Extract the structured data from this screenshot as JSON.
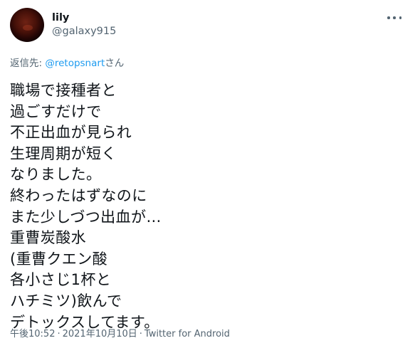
{
  "author": {
    "display_name": "lily",
    "handle": "@galaxy915"
  },
  "reply": {
    "prefix": "返信先: ",
    "mention": "@retopsnart",
    "suffix": "さん"
  },
  "tweet_lines": [
    "職場で接種者と",
    "過ごすだけで",
    "不正出血が見られ",
    "生理周期が短く",
    "なりました。",
    "終わったはずなのに",
    "また少しづつ出血が…",
    "重曹炭酸水",
    "(重曹クエン酸",
    "各小さじ1杯と",
    "ハチミツ)飲んで",
    "デトックスしてます。"
  ],
  "meta": {
    "time": "午後10:52",
    "separator": "·",
    "date": "2021年10月10日",
    "source": "Twitter for Android"
  },
  "icons": {
    "more": "more-horizontal-icon",
    "avatar": "lunar-eclipse-avatar"
  },
  "colors": {
    "text_primary": "#0f1419",
    "text_secondary": "#536471",
    "accent": "#1d9bf0",
    "background": "#ffffff"
  }
}
